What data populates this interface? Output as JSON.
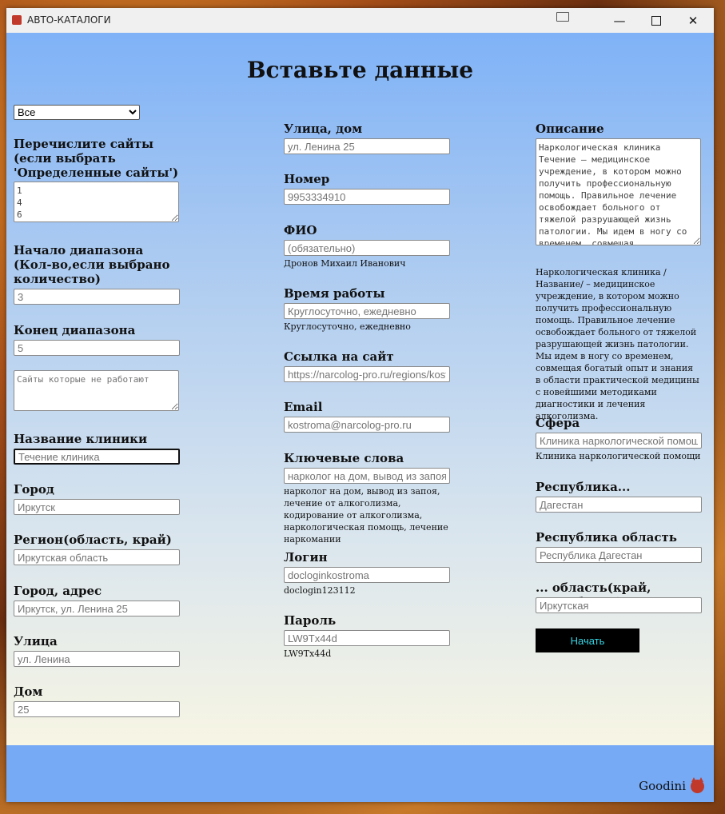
{
  "window": {
    "title": "АВТО-КАТАЛОГИ"
  },
  "page": {
    "title": "Вставьте данные"
  },
  "col1": {
    "select_value": "Все",
    "select_options": [
      "Все"
    ],
    "sites_label": "Перечислите сайты\n(если выбрать 'Определенные сайты')",
    "sites_value": "1\n4\n6",
    "range_start_label": "Начало диапазона\n(Кол-во,если выбрано количество)",
    "range_start_placeholder": "3",
    "range_end_label": "Конец диапазона",
    "range_end_placeholder": "5",
    "broken_sites_placeholder": "Сайты которые не работают",
    "clinic_name_label": "Название клиники",
    "clinic_name_placeholder": "Течение клиника",
    "city_label": "Город",
    "city_placeholder": "Иркутск",
    "region_label": "Регион(область, край)",
    "region_placeholder": "Иркутская область",
    "city_address_label": "Город, адрес",
    "city_address_placeholder": "Иркутск, ул. Ленина 25",
    "street_label": "Улица",
    "street_placeholder": "ул. Ленина",
    "house_label": "Дом",
    "house_placeholder": "25"
  },
  "col2": {
    "street_house_label": "Улица, дом",
    "street_house_placeholder": "ул. Ленина 25",
    "phone_label": "Номер",
    "phone_placeholder": "9953334910",
    "fio_label": "ФИО",
    "fio_placeholder": "(обязательно)",
    "fio_note": "Дронов Михаил Иванович",
    "hours_label": "Время работы",
    "hours_placeholder": "Круглосуточно, ежедневно",
    "hours_note": "Круглосуточно, ежедневно",
    "site_link_label": "Ссылка на сайт",
    "site_link_placeholder": "https://narcolog-pro.ru/regions/kostroma",
    "email_label": "Email",
    "email_placeholder": "kostroma@narcolog-pro.ru",
    "keywords_label": "Ключевые слова",
    "keywords_placeholder": "нарколог на дом, вывод из запоя",
    "keywords_note": "нарколог на дом, вывод из запоя, лечение от алкоголизма, кодирование от алкоголизма, наркологическая помощь, лечение наркомании",
    "login_label": "Логин",
    "login_placeholder": "docloginkostroma",
    "login_note": "doclogin123112",
    "password_label": "Пароль",
    "password_placeholder": "LW9Tx44d",
    "password_note": "LW9Tx44d"
  },
  "col3": {
    "description_label": "Описание",
    "description_value": "Наркологическая клиника Течение – медицинское учреждение, в котором можно получить профессиональную помощь. Правильное лечение освобождает больного от тяжелой разрушающей жизнь патологии. Мы идем в ногу со временем, совмещая",
    "description_note": "Наркологическая клиника /Название/ – медицинское учреждение, в котором можно получить профессиональную помощь. Правильное лечение освобождает больного от тяжелой разрушающей жизнь патологии. Мы идем в ногу со временем, совмещая богатый опыт и знания в области практической медицины с новейшими методиками диагностики и лечения алкоголизма.",
    "sphere_label": "Сфера",
    "sphere_placeholder": "Клиника наркологической помощи",
    "sphere_note": "Клиника наркологической помощи",
    "republic_label": "Республика...",
    "republic_placeholder": "Дагестан",
    "republic_region_label": "Республика область",
    "republic_region_placeholder": "Республика Дагестан",
    "oblast_label": "... область(край, республика)",
    "oblast_placeholder": "Иркутская",
    "start_button": "Начать"
  },
  "footer": {
    "brand": "Goodini"
  }
}
